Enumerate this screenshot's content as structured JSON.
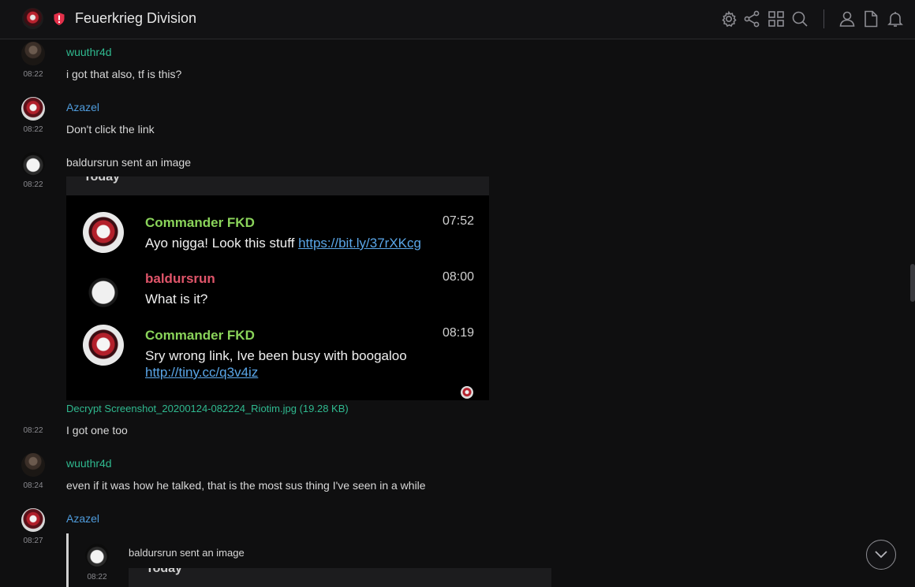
{
  "header": {
    "room_name": "Feuerkrieg Division",
    "icons": [
      "settings-icon",
      "share-icon",
      "apps-icon",
      "search-icon",
      "members-icon",
      "files-icon",
      "notifications-icon"
    ]
  },
  "colors": {
    "accent_green": "#2fb98f",
    "accent_blue": "#4f9cdd",
    "background": "#0f0f10",
    "warning_red": "#e3304a"
  },
  "messages": [
    {
      "sender": "wuuthr4d",
      "time": "08:22",
      "text": "i got that also, tf is this?"
    },
    {
      "sender": "Azazel",
      "time": "08:22",
      "text": "Don't click the link"
    },
    {
      "time": "08:22",
      "text": "baldursrun sent an image"
    },
    {
      "time": "08:22",
      "text": "I got one too"
    },
    {
      "sender": "wuuthr4d",
      "time": "08:24",
      "text": "even if it was how he talked, that is the most sus thing I've seen in a while"
    },
    {
      "sender": "Azazel",
      "time": "08:27"
    }
  ],
  "image_caption": "Decrypt Screenshot_20200124-082224_Riotim.jpg (19.28 KB)",
  "screenshot": {
    "day_label": "Today",
    "entries": [
      {
        "name": "Commander FKD",
        "time": "07:52",
        "text": "Ayo nigga! Look this stuff ",
        "link": "https://bit.ly/37rXKcg"
      },
      {
        "name": "baldursrun",
        "time": "08:00",
        "text": "What is it?"
      },
      {
        "name": "Commander FKD",
        "time": "08:19",
        "text": "Sry wrong link, Ive been busy with boogaloo",
        "link": "http://tiny.cc/q3v4iz"
      }
    ]
  },
  "quote": {
    "time": "08:22",
    "text": "baldursrun sent an image",
    "day_label": "Today"
  }
}
